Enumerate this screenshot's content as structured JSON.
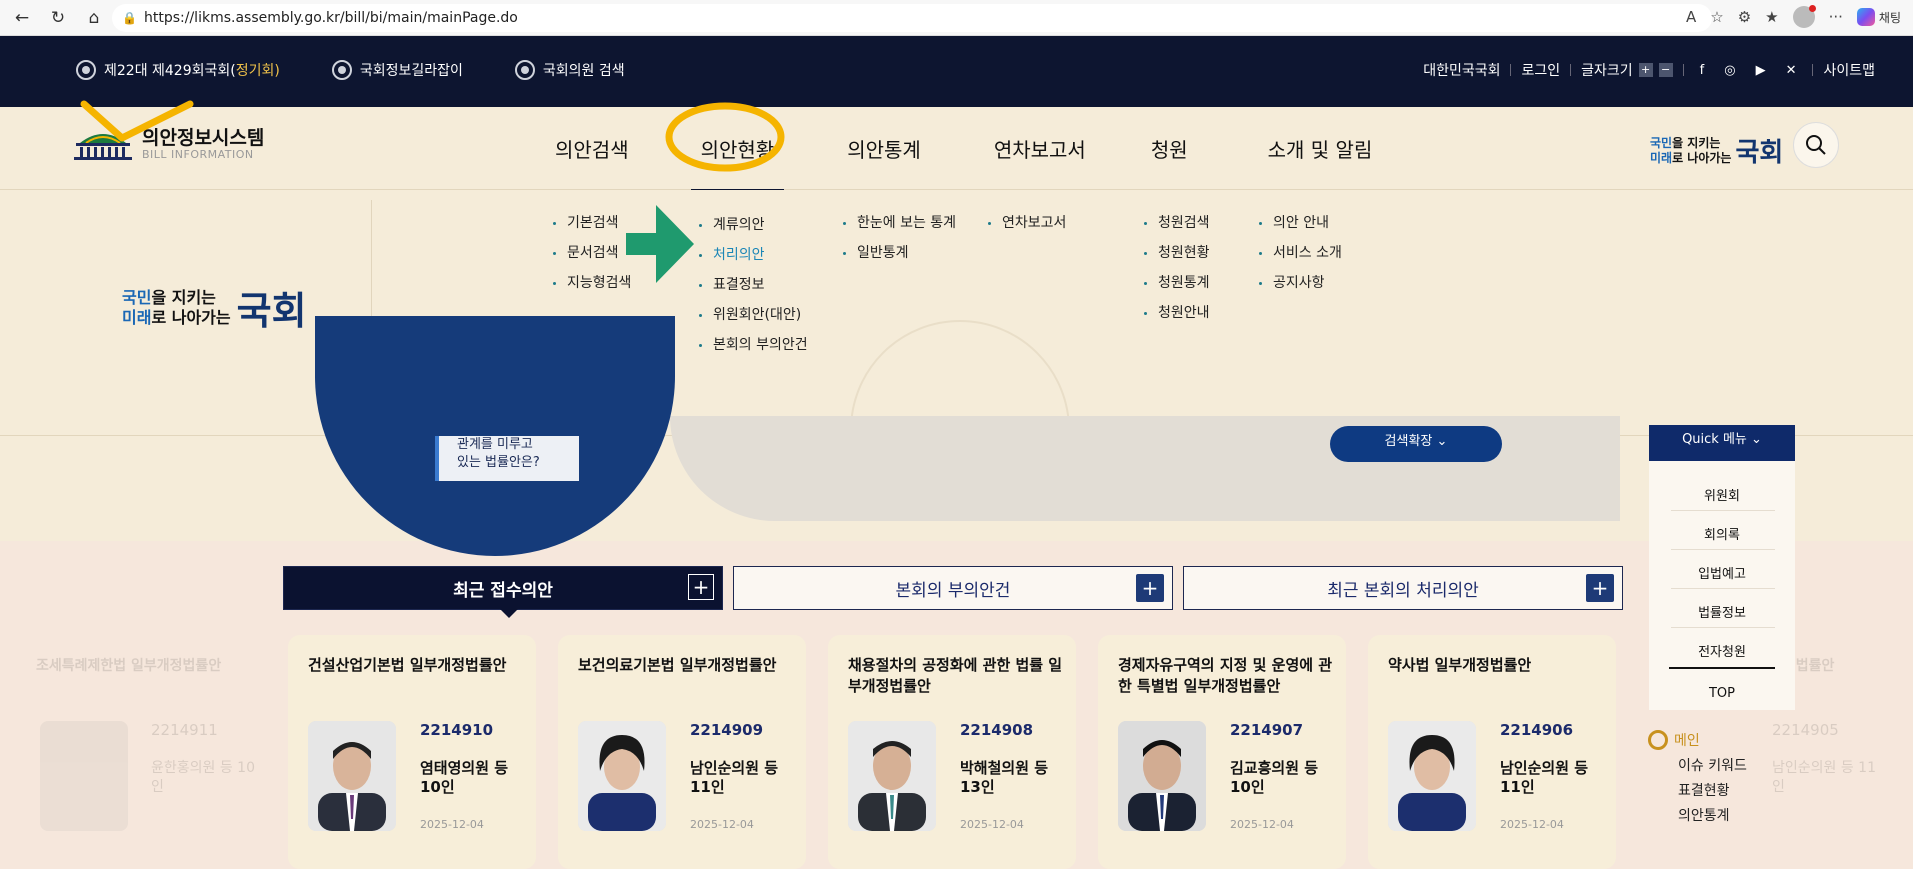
{
  "browser": {
    "url": "https://likms.assembly.go.kr/bill/bi/main/mainPage.do",
    "chat_label": "채팅"
  },
  "topbar": {
    "session_prefix": "제22대 제429회국회(",
    "session_highlight": "정기회",
    "session_suffix": ")",
    "guide": "국회정보길라잡이",
    "member_search": "국회의원 검색",
    "national_assembly": "대한민국국회",
    "login": "로그인",
    "font_size": "글자크기",
    "sitemap": "사이트맵"
  },
  "header": {
    "logo_title": "의안정보시스템",
    "logo_sub": "BILL INFORMATION",
    "nav": [
      "의안검색",
      "의안현황",
      "의안통계",
      "연차보고서",
      "청원",
      "소개 및 알림"
    ],
    "slogan_line1a": "국민",
    "slogan_line1b": "을 지키는",
    "slogan_line2a": "미래",
    "slogan_line2b": "로 나아가는",
    "slogan_big": "국회"
  },
  "mega": {
    "col1": [
      "기본검색",
      "문서검색",
      "지능형검색"
    ],
    "col2": [
      "계류의안",
      "처리의안",
      "표결정보",
      "위원회안(대안)",
      "본회의 부의안건"
    ],
    "col3": [
      "한눈에 보는 통계",
      "일반통계"
    ],
    "col4": [
      "연차보고서"
    ],
    "col5": [
      "청원검색",
      "청원현황",
      "청원통계",
      "청원안내"
    ],
    "col6": [
      "의안 안내",
      "서비스 소개",
      "공지사항"
    ]
  },
  "hero": {
    "card_line1": "관계를 미루고",
    "card_line2": "있는 법률안은?",
    "pill": "검색확장"
  },
  "tabs": [
    {
      "label": "최근 접수의안"
    },
    {
      "label": "본회의 부의안건"
    },
    {
      "label": "최근 본회의 처리의안"
    }
  ],
  "bills": [
    {
      "title": "건설산업기본법 일부개정법률안",
      "number": "2214910",
      "proposer": "염태영의원 등 10인",
      "date": "2025-12-04"
    },
    {
      "title": "보건의료기본법 일부개정법률안",
      "number": "2214909",
      "proposer": "남인순의원 등 11인",
      "date": "2025-12-04"
    },
    {
      "title": "채용절차의 공정화에 관한 법률 일부개정법률안",
      "number": "2214908",
      "proposer": "박해철의원 등 13인",
      "date": "2025-12-04"
    },
    {
      "title": "경제자유구역의 지정 및 운영에 관한 특별법 일부개정법률안",
      "number": "2214907",
      "proposer": "김교흥의원 등 10인",
      "date": "2025-12-04"
    },
    {
      "title": "약사법 일부개정법률안",
      "number": "2214906",
      "proposer": "남인순의원 등 11인",
      "date": "2025-12-04"
    }
  ],
  "ghost_left": {
    "title": "조세특례제한법 일부개정법률안",
    "number": "2214911",
    "proposer": "윤한홍의원 등 10인"
  },
  "ghost_right": {
    "title": "개정법률안",
    "number": "2214905",
    "proposer": "남인순의원 등 11인"
  },
  "quick": {
    "head": "Quick 메뉴",
    "items": [
      "위원회",
      "회의록",
      "입법예고",
      "법률정보",
      "전자청원"
    ],
    "top": "TOP"
  },
  "side_nav": {
    "main": "메인",
    "items": [
      "이슈 키워드",
      "표결현황",
      "의안통계"
    ]
  },
  "colors": {
    "navy": "#0d1530",
    "gold": "#f0c24a",
    "highlight_circle": "#f5b400",
    "arrow": "#1f9a6e"
  }
}
